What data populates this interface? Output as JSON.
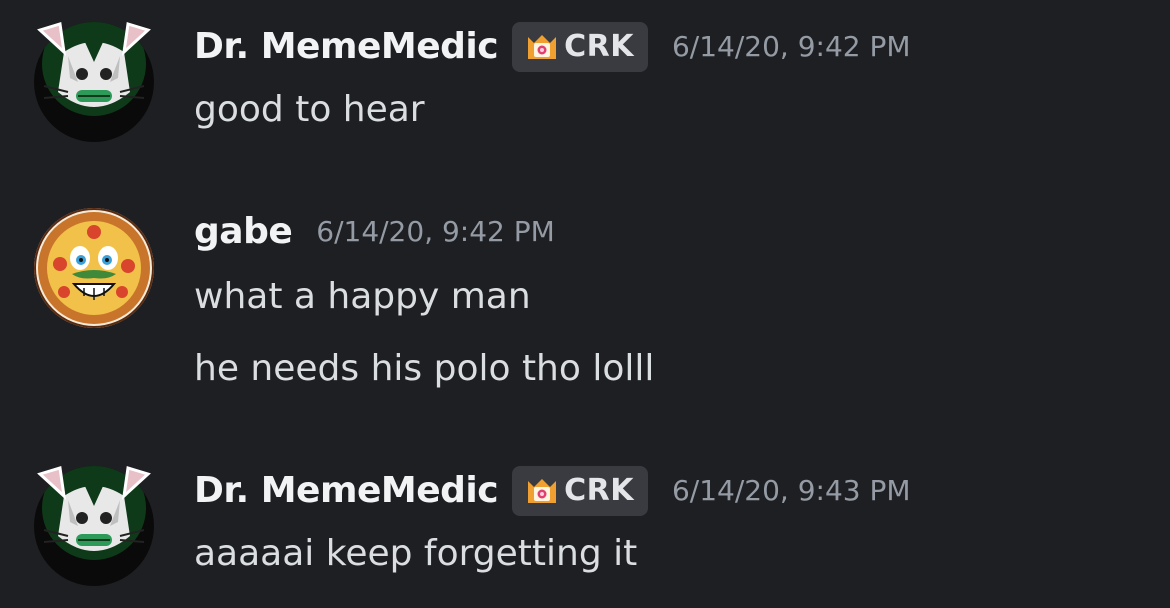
{
  "messages": [
    {
      "author": "Dr. MemeMedic",
      "avatar_icon": "cat-avatar-icon",
      "tag": {
        "icon": "crown-badge-icon",
        "label": "CRK",
        "accent": "#f0a030",
        "gem": "#e04070"
      },
      "timestamp": "6/14/20, 9:42 PM",
      "lines": [
        "good to hear"
      ]
    },
    {
      "author": "gabe",
      "avatar_icon": "pizza-face-avatar-icon",
      "timestamp": "6/14/20, 9:42 PM",
      "lines": [
        "what a happy man",
        "he needs his polo tho lolll"
      ]
    },
    {
      "author": "Dr. MemeMedic",
      "avatar_icon": "cat-avatar-icon",
      "tag": {
        "icon": "crown-badge-icon",
        "label": "CRK",
        "accent": "#f0a030",
        "gem": "#e04070"
      },
      "timestamp": "6/14/20, 9:43 PM",
      "lines": [
        "aaaaai keep forgetting it"
      ]
    }
  ],
  "colors": {
    "background": "#1e1f22",
    "username": "#f2f3f5",
    "message_text": "#dbdee1",
    "timestamp": "#949ba4",
    "tag_background": "#3a3b41"
  }
}
